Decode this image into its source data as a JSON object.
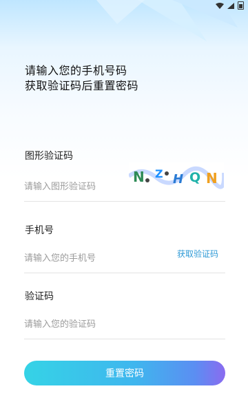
{
  "header": {
    "title_line1": "请输入您的手机号码",
    "title_line2": "获取验证码后重置密码"
  },
  "form": {
    "captcha": {
      "label": "图形验证码",
      "placeholder": "请输入图形验证码",
      "image_text": "NZHQN"
    },
    "phone": {
      "label": "手机号",
      "placeholder": "请输入您的手机号",
      "get_code_label": "获取验证码"
    },
    "code": {
      "label": "验证码",
      "placeholder": "请输入您的验证码"
    }
  },
  "actions": {
    "reset_label": "重置密码"
  },
  "colors": {
    "accent": "#2f9ad6",
    "button_start": "#35d3e6",
    "button_end": "#8a6bf0"
  }
}
